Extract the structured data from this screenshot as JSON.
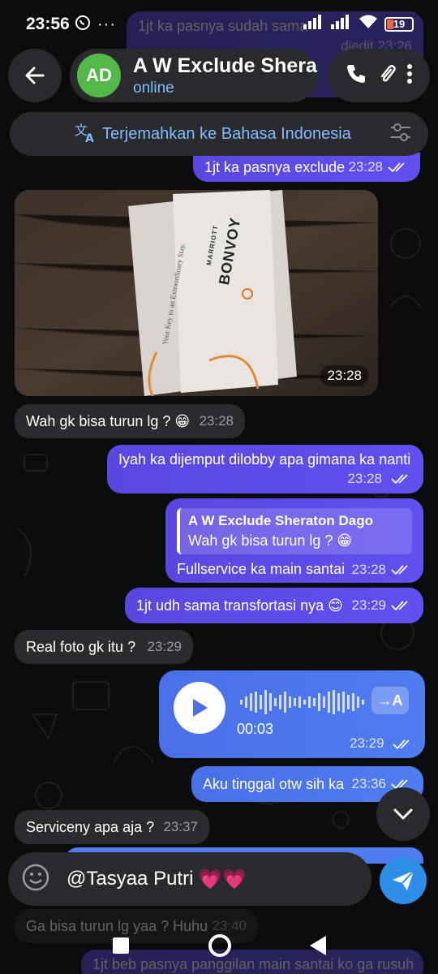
{
  "status_bar": {
    "time": "23:56",
    "battery": "19"
  },
  "header": {
    "avatar_initials": "AD",
    "name": "A W Exclude Shera",
    "status": "online"
  },
  "translate_bar": {
    "label": "Terjemahkan ke Bahasa Indonesia"
  },
  "background_previews": [
    {
      "text": "1jt ka pasnya sudah sama",
      "time": "diedit 23:26"
    }
  ],
  "messages": [
    {
      "id": "m1",
      "direction": "out",
      "text": "1jt ka pasnya exclude",
      "time": "23:28",
      "read": true
    },
    {
      "id": "m2",
      "direction": "in",
      "type": "photo",
      "time": "23:28"
    },
    {
      "id": "m3",
      "direction": "in",
      "text": "Wah gk bisa turun lg ? 😁",
      "time": "23:28"
    },
    {
      "id": "m4",
      "direction": "out",
      "text": "Iyah ka dijemput dilobby apa gimana ka nanti",
      "time": "23:28",
      "read": true
    },
    {
      "id": "m5",
      "direction": "out",
      "reply_to": {
        "name": "A W Exclude Sheraton Dago",
        "text": "Wah gk bisa turun lg ? 😁"
      },
      "text": "Fullservice ka main santai",
      "time": "23:28",
      "read": true
    },
    {
      "id": "m6",
      "direction": "out",
      "text": "1jt udh sama transfortasi nya 😊",
      "time": "23:29",
      "read": true
    },
    {
      "id": "m7",
      "direction": "in",
      "text": "Real foto gk itu ?",
      "time": "23:29"
    },
    {
      "id": "m8",
      "direction": "out",
      "type": "voice",
      "duration": "00:03",
      "transcribe_label": "→A",
      "time": "23:29",
      "read": true
    },
    {
      "id": "m9",
      "direction": "out",
      "text": "Aku tinggal otw sih ka",
      "time": "23:36",
      "read": true
    },
    {
      "id": "m10",
      "direction": "in",
      "text": "Serviceny apa aja ?",
      "time": "23:37"
    }
  ],
  "photo": {
    "brand_line1": "MARRIOTT",
    "brand_line2": "BONVOY",
    "tagline": "Your Key to an Extraordinary Stay."
  },
  "composer": {
    "text": "@Tasyaa Putri",
    "emoji": "💗💗"
  },
  "below_composer": [
    {
      "text": "Ga bisa turun lg yaa ? Huhu",
      "time": "23:40"
    },
    {
      "text": "1jt beb pasnya panggilan main santai ko ga rusuh"
    }
  ],
  "colors": {
    "outgoing": "#5a47e0",
    "incoming": "#2b2b2f",
    "accent": "#2e8de6",
    "avatar": "#52b848",
    "link": "#7fbcff"
  }
}
